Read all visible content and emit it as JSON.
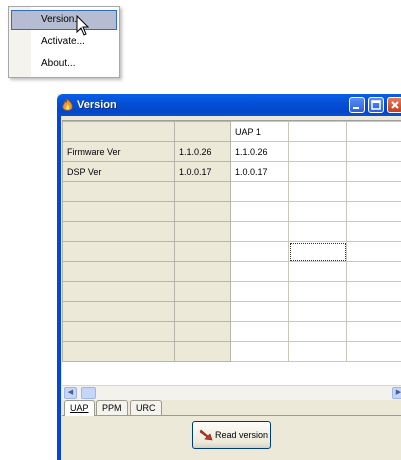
{
  "menu": {
    "items": [
      {
        "label": "Version..."
      },
      {
        "label": "Activate..."
      },
      {
        "label": "About..."
      }
    ]
  },
  "window": {
    "title": "Version",
    "icon": "app-flame-icon",
    "controls": [
      "minimize-icon",
      "maximize-icon",
      "close-icon"
    ]
  },
  "grid": {
    "header": [
      "",
      "",
      "UAP 1",
      "",
      ""
    ],
    "rows": [
      [
        "Firmware Ver",
        "1.1.0.26",
        "1.1.0.26",
        "",
        ""
      ],
      [
        "DSP Ver",
        "1.0.0.17",
        "1.0.0.17",
        "",
        ""
      ],
      [
        "",
        "",
        "",
        "",
        ""
      ],
      [
        "",
        "",
        "",
        "",
        ""
      ],
      [
        "",
        "",
        "",
        "",
        ""
      ],
      [
        "",
        "",
        "",
        "",
        ""
      ],
      [
        "",
        "",
        "",
        "",
        ""
      ],
      [
        "",
        "",
        "",
        "",
        ""
      ],
      [
        "",
        "",
        "",
        "",
        ""
      ],
      [
        "",
        "",
        "",
        "",
        ""
      ],
      [
        "",
        "",
        "",
        "",
        ""
      ]
    ]
  },
  "tabs": [
    {
      "label": "UAP"
    },
    {
      "label": "PPM"
    },
    {
      "label": "URC"
    }
  ],
  "read_button": {
    "label": "Read version",
    "icon": "read-arrow-icon"
  },
  "colors": {
    "titlebar": "#0550d7",
    "menu_highlight": "#b6bdd2",
    "fixed_cell": "#ece9d8"
  }
}
